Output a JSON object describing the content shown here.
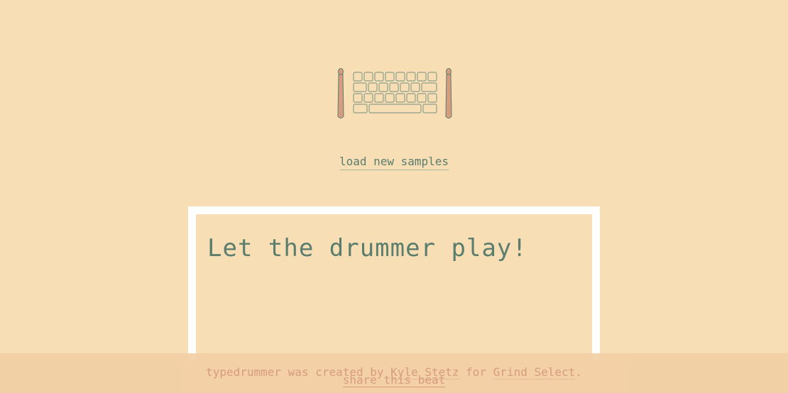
{
  "logo": {
    "icon": "keyboard-with-drumsticks-icon"
  },
  "load_link_label": "load new samples",
  "editor": {
    "text": "Let the drummer play!"
  },
  "footer": {
    "credit_prefix": "typedrummer was created by ",
    "author_link": "Kyle Stetz",
    "credit_middle": " for ",
    "company_link": "Grind Select",
    "credit_suffix": ".",
    "share_label": "share this beat"
  },
  "colors": {
    "background": "#f7deb5",
    "text_green": "#5b7d6e",
    "footer_text": "#d79b7e",
    "frame": "#ffffff",
    "footer_bg": "#f2cea3"
  }
}
